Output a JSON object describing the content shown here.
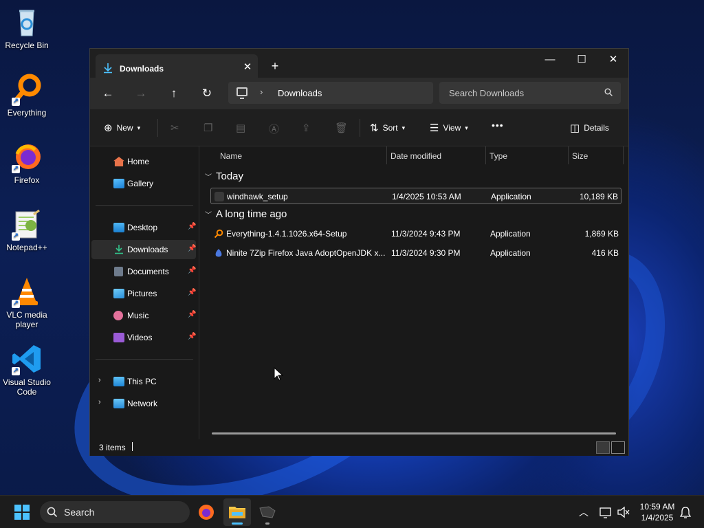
{
  "desktop": {
    "icons": [
      {
        "label": "Recycle Bin"
      },
      {
        "label": "Everything"
      },
      {
        "label": "Firefox"
      },
      {
        "label": "Notepad++"
      },
      {
        "label": "VLC media player"
      },
      {
        "label": "Visual Studio Code"
      }
    ]
  },
  "window": {
    "tab_title": "Downloads",
    "new_tab_glyph": "+",
    "controls": {
      "minimize": "—",
      "maximize": "☐",
      "close": "✕"
    },
    "address": {
      "crumb": "Downloads"
    },
    "search_placeholder": "Search Downloads",
    "commands": {
      "new": "New",
      "sort": "Sort",
      "view": "View",
      "more": "•••",
      "details": "Details"
    },
    "nav_pane": {
      "items": [
        {
          "label": "Home",
          "icon": "home-icon"
        },
        {
          "label": "Gallery",
          "icon": "gallery-icon"
        },
        {
          "label": "Desktop",
          "icon": "desktop-folder-icon",
          "pinned": true
        },
        {
          "label": "Downloads",
          "icon": "downloads-folder-icon",
          "pinned": true,
          "selected": true
        },
        {
          "label": "Documents",
          "icon": "documents-folder-icon",
          "pinned": true
        },
        {
          "label": "Pictures",
          "icon": "pictures-folder-icon",
          "pinned": true
        },
        {
          "label": "Music",
          "icon": "music-folder-icon",
          "pinned": true
        },
        {
          "label": "Videos",
          "icon": "videos-folder-icon",
          "pinned": true
        },
        {
          "label": "This PC",
          "icon": "this-pc-icon"
        },
        {
          "label": "Network",
          "icon": "network-icon"
        }
      ]
    },
    "columns": {
      "name": "Name",
      "date": "Date modified",
      "type": "Type",
      "size": "Size"
    },
    "groups": [
      {
        "label": "Today",
        "files": [
          {
            "name": "windhawk_setup",
            "date": "1/4/2025 10:53 AM",
            "type": "Application",
            "size": "10,189 KB",
            "selected": true
          }
        ]
      },
      {
        "label": "A long time ago",
        "files": [
          {
            "name": "Everything-1.4.1.1026.x64-Setup",
            "date": "11/3/2024 9:43 PM",
            "type": "Application",
            "size": "1,869 KB"
          },
          {
            "name": "Ninite 7Zip Firefox Java AdoptOpenJDK x...",
            "date": "11/3/2024 9:30 PM",
            "type": "Application",
            "size": "416 KB"
          }
        ]
      }
    ],
    "status": {
      "count": "3 items"
    }
  },
  "taskbar": {
    "search_label": "Search",
    "time": "10:59 AM",
    "date": "1/4/2025"
  },
  "colors": {
    "accent": "#4cc2ff",
    "window_bg": "#191919",
    "taskbar_bg": "#1c1c1c"
  }
}
